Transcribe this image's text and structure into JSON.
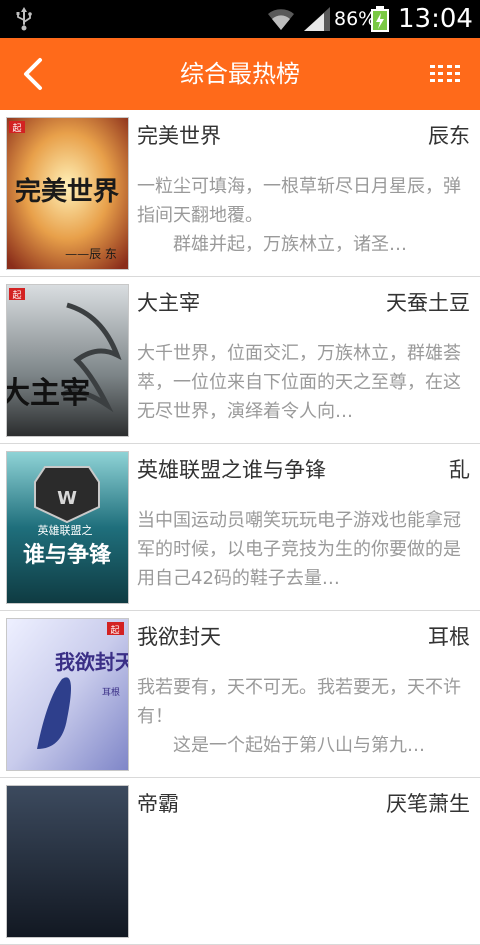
{
  "status_bar": {
    "battery_percent": "86%",
    "time": "13:04",
    "icons": [
      "usb-icon",
      "wifi-icon",
      "signal-icon",
      "battery-icon"
    ]
  },
  "header": {
    "title": "综合最热榜",
    "back_icon": "chevron-left-icon",
    "menu_icon": "list-menu-icon"
  },
  "colors": {
    "accent": "#ff6a1a",
    "status_bar": "#000000",
    "title_text": "#333333",
    "desc_text": "#9a9a9a"
  },
  "books": [
    {
      "title": "完美世界",
      "author": "辰东",
      "desc": "一粒尘可填海，一根草斩尽日月星辰，弹指间天翻地覆。\n　　群雄并起，万族林立，诸圣…",
      "cover_text": "完美世界",
      "cover_sub": "——辰 东"
    },
    {
      "title": "大主宰",
      "author": "天蚕土豆",
      "desc": "大千世界，位面交汇，万族林立，群雄荟萃，一位位来自下位面的天之至尊，在这无尽世界，演绎着令人向…",
      "cover_text": "大主宰"
    },
    {
      "title": "英雄联盟之谁与争锋",
      "author": "乱",
      "desc": "当中国运动员嘲笑玩玩电子游戏也能拿冠军的时候，以电子竞技为生的你要做的是用自己42码的鞋子去量…",
      "cover_text": "谁与争锋",
      "cover_sub": "英雄联盟之"
    },
    {
      "title": "我欲封天",
      "author": "耳根",
      "desc": "我若要有，天不可无。我若要无，天不许有！\n　　这是一个起始于第八山与第九…",
      "cover_text": "我欲封天",
      "cover_sub": "耳根"
    },
    {
      "title": "帝霸",
      "author": "厌笔萧生",
      "desc": "",
      "cover_text": ""
    }
  ]
}
